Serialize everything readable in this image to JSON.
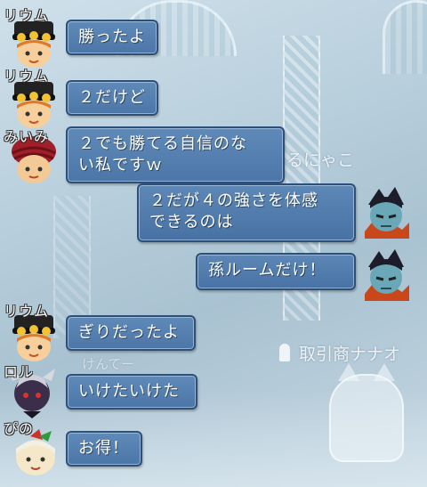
{
  "background": {
    "overlay_labels": [
      {
        "id": "player_label",
        "text": "るにゃこ"
      },
      {
        "id": "npc_label",
        "text": "取引商ナナオ"
      },
      {
        "id": "faded_label",
        "text": "けんてー"
      }
    ]
  },
  "chat": {
    "messages": [
      {
        "speaker": "リウム",
        "text": "勝ったよ",
        "side": "left",
        "avatar": "rium-avatar"
      },
      {
        "speaker": "リウム",
        "text": "２だけど",
        "side": "left",
        "avatar": "rium-avatar"
      },
      {
        "speaker": "みいみ",
        "text": "２でも勝てる自信のな\nい私ですｗ",
        "side": "left",
        "avatar": "miimi-avatar"
      },
      {
        "speaker": "",
        "text": "２だが４の強さを体感\nできるのは",
        "side": "right",
        "avatar": "self-avatar"
      },
      {
        "speaker": "",
        "text": "孫ルームだけ！",
        "side": "right",
        "avatar": "self-avatar"
      },
      {
        "speaker": "リウム",
        "text": "ぎりだったよ",
        "side": "left",
        "avatar": "rium-avatar"
      },
      {
        "speaker": "ロル",
        "text": "いけたいけた",
        "side": "left",
        "avatar": "roru-avatar"
      },
      {
        "speaker": "ぴの",
        "text": "お得！",
        "side": "left",
        "avatar": "pino-avatar"
      }
    ]
  },
  "colors": {
    "bubble_fill": "#4f7aab",
    "bubble_border": "#2e4f78",
    "name_outline": "#2b2b2b"
  }
}
